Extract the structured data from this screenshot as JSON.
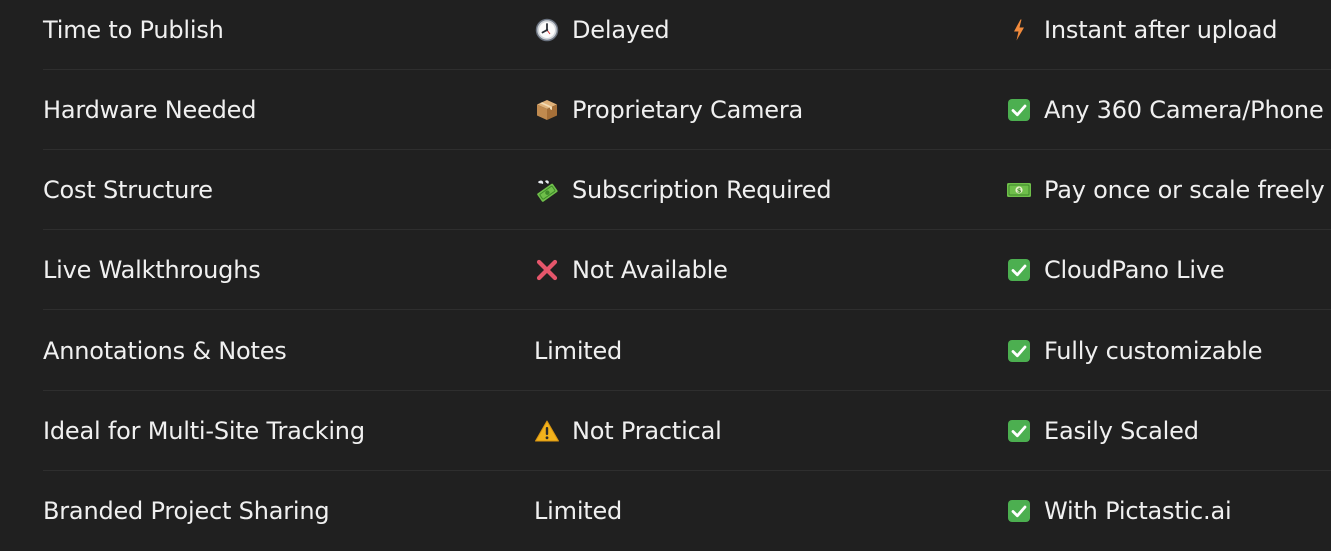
{
  "rows": [
    {
      "feature": "Time to Publish",
      "competitor": {
        "icon": "clock-icon",
        "text": "Delayed"
      },
      "cloudpano": {
        "icon": "lightning-icon",
        "text": "Instant after upload"
      }
    },
    {
      "feature": "Hardware Needed",
      "competitor": {
        "icon": "package-icon",
        "text": "Proprietary Camera"
      },
      "cloudpano": {
        "icon": "check-icon",
        "text": "Any 360 Camera/Phone"
      }
    },
    {
      "feature": "Cost Structure",
      "competitor": {
        "icon": "money-flying-icon",
        "text": "Subscription Required"
      },
      "cloudpano": {
        "icon": "dollar-bill-icon",
        "text": "Pay once or scale freely"
      }
    },
    {
      "feature": "Live Walkthroughs",
      "competitor": {
        "icon": "cross-icon",
        "text": "Not Available"
      },
      "cloudpano": {
        "icon": "check-icon",
        "text": "CloudPano Live"
      }
    },
    {
      "feature": "Annotations & Notes",
      "competitor": {
        "icon": "",
        "text": "Limited"
      },
      "cloudpano": {
        "icon": "check-icon",
        "text": "Fully customizable"
      }
    },
    {
      "feature": "Ideal for Multi-Site Tracking",
      "competitor": {
        "icon": "warning-icon",
        "text": "Not Practical"
      },
      "cloudpano": {
        "icon": "check-icon",
        "text": "Easily Scaled"
      }
    },
    {
      "feature": "Branded Project Sharing",
      "competitor": {
        "icon": "",
        "text": "Limited"
      },
      "cloudpano": {
        "icon": "check-icon",
        "text": "With Pictastic.ai"
      }
    }
  ],
  "colors": {
    "background": "#202020",
    "text": "#f0f0f0",
    "divider": "#2e2e2e",
    "check_green": "#4caf50",
    "cross_red": "#e5566b",
    "warning_yellow": "#f2b21c",
    "lightning_orange": "#f08a3c"
  }
}
